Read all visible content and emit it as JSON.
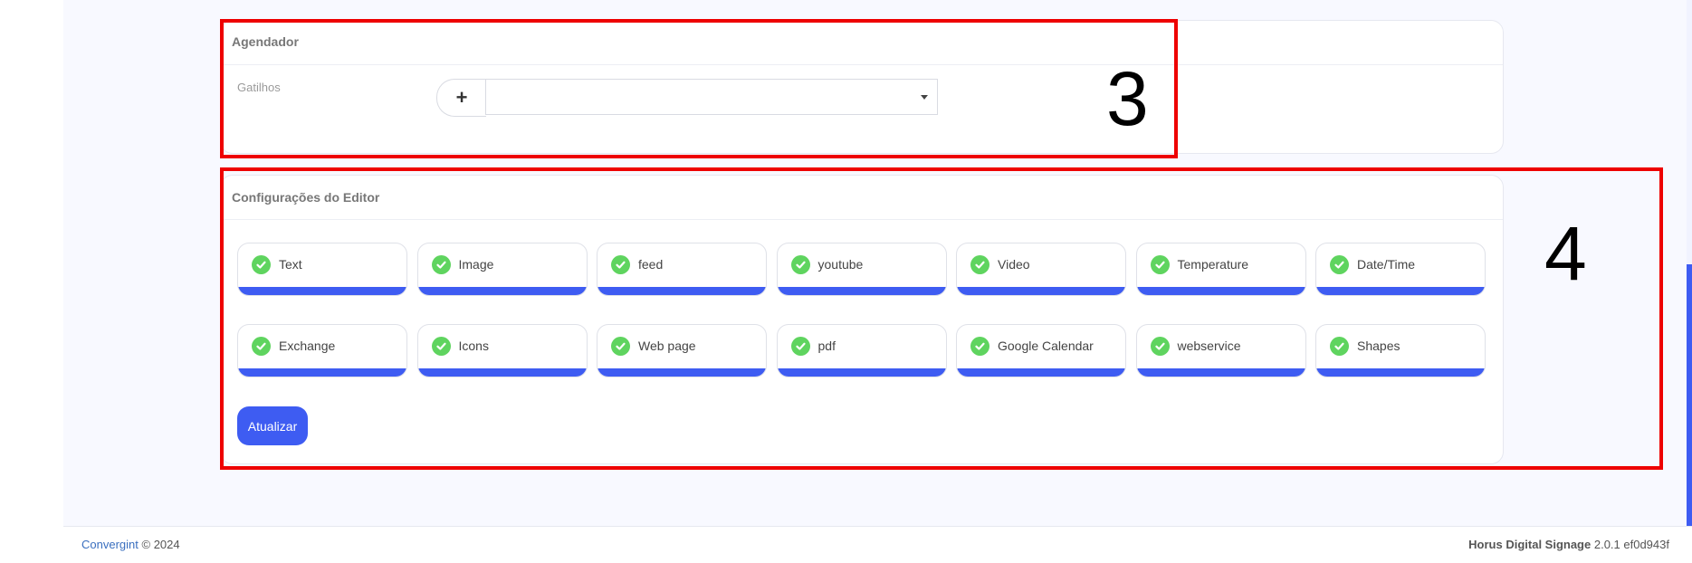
{
  "scheduler": {
    "title": "Agendador",
    "triggers_label": "Gatilhos",
    "add_symbol": "+",
    "select_value": ""
  },
  "editor": {
    "title": "Configurações do Editor",
    "widgets": [
      {
        "label": "Text",
        "checked": true
      },
      {
        "label": "Image",
        "checked": true
      },
      {
        "label": "feed",
        "checked": true
      },
      {
        "label": "youtube",
        "checked": true
      },
      {
        "label": "Video",
        "checked": true
      },
      {
        "label": "Temperature",
        "checked": true
      },
      {
        "label": "Date/Time",
        "checked": true
      },
      {
        "label": "Exchange",
        "checked": true
      },
      {
        "label": "Icons",
        "checked": true
      },
      {
        "label": "Web page",
        "checked": true
      },
      {
        "label": "pdf",
        "checked": true
      },
      {
        "label": "Google Calendar",
        "checked": true
      },
      {
        "label": "webservice",
        "checked": true
      },
      {
        "label": "Shapes",
        "checked": true
      }
    ],
    "update_label": "Atualizar"
  },
  "annotations": {
    "box3": "3",
    "box4": "4"
  },
  "footer": {
    "company": "Convergint",
    "copyright": "© 2024",
    "product": "Horus Digital Signage",
    "version": "2.0.1 ef0d943f"
  },
  "colors": {
    "accent": "#3e5cf2",
    "check": "#5fd45f",
    "annotation": "#ee0000"
  }
}
